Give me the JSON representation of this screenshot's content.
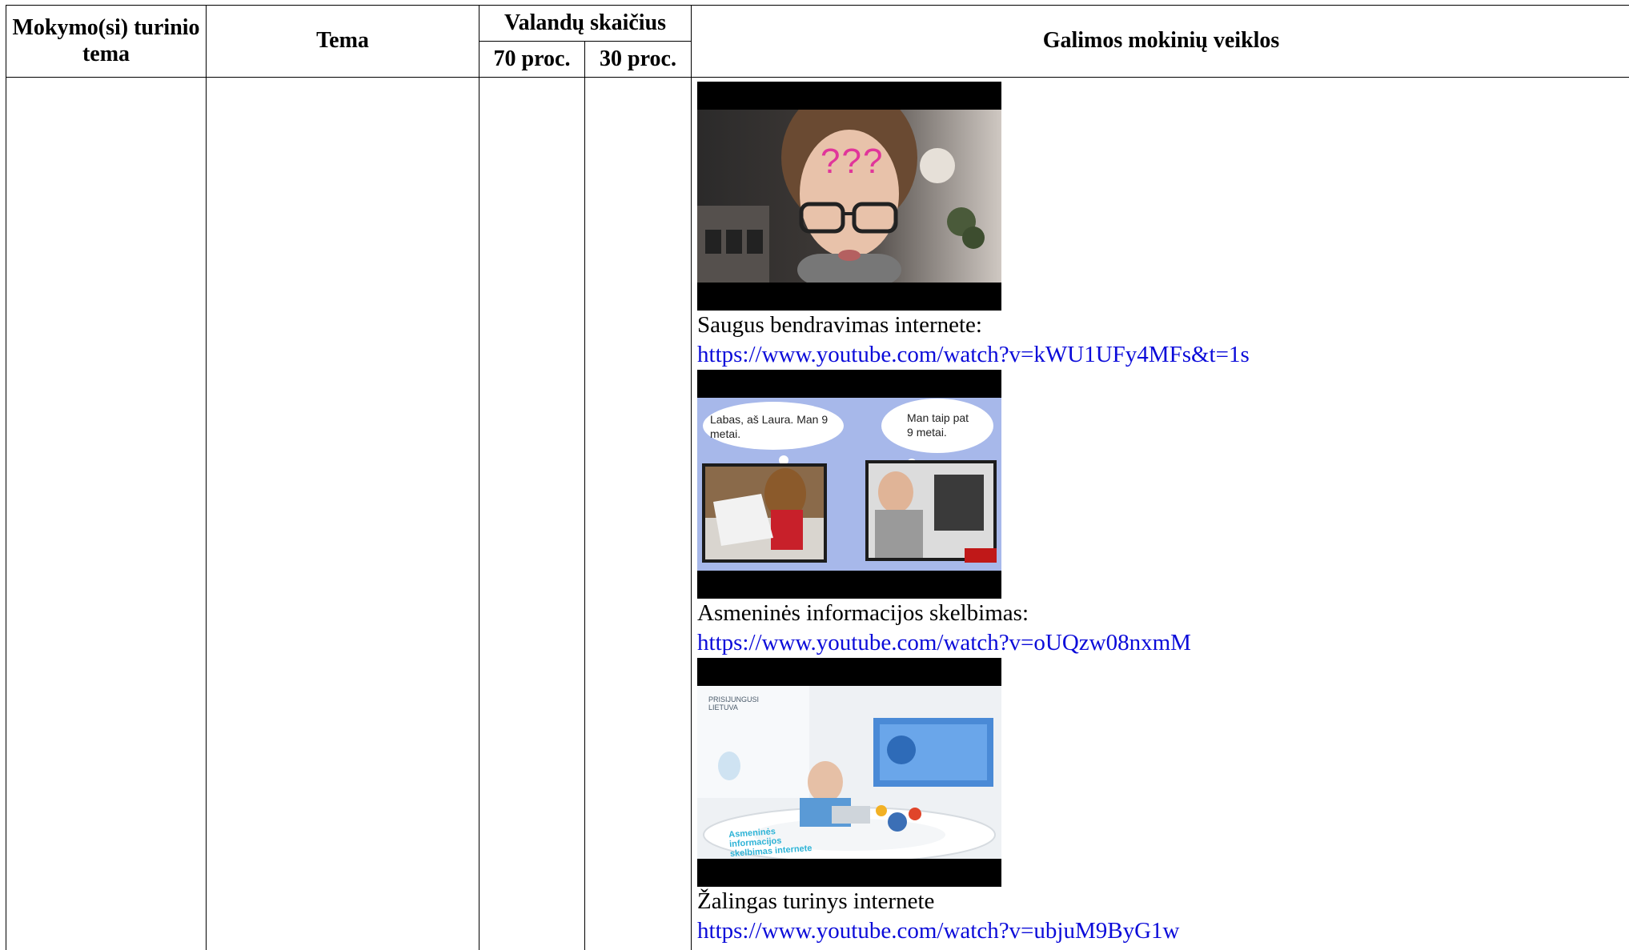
{
  "header": {
    "col1": "Mokymo(si) turinio tema",
    "col2": "Tema",
    "col3": "Valandų skaičius",
    "col3a": "70 proc.",
    "col3b": "30 proc.",
    "col4": "Galimos mokinių veiklos"
  },
  "videos": [
    {
      "caption": "Saugus bendravimas internete:",
      "url": "https://www.youtube.com/watch?v=kWU1UFy4MFs&t=1s",
      "thumb_text": "???"
    },
    {
      "caption": "Asmeninės informacijos skelbimas:",
      "url": "https://www.youtube.com/watch?v=oUQzw08nxmM",
      "bubble_left": "Labas, aš Laura. Man 9 metai.",
      "bubble_right": "Man taip pat 9 metai."
    },
    {
      "caption": "Žalingas turinys internete",
      "url": "https://www.youtube.com/watch?v=ubjuM9ByG1w",
      "logo_text": "PRISIJUNGUSI LIETUVA",
      "desk_text": "Asmeninės informacijos skelbimas internete"
    }
  ]
}
